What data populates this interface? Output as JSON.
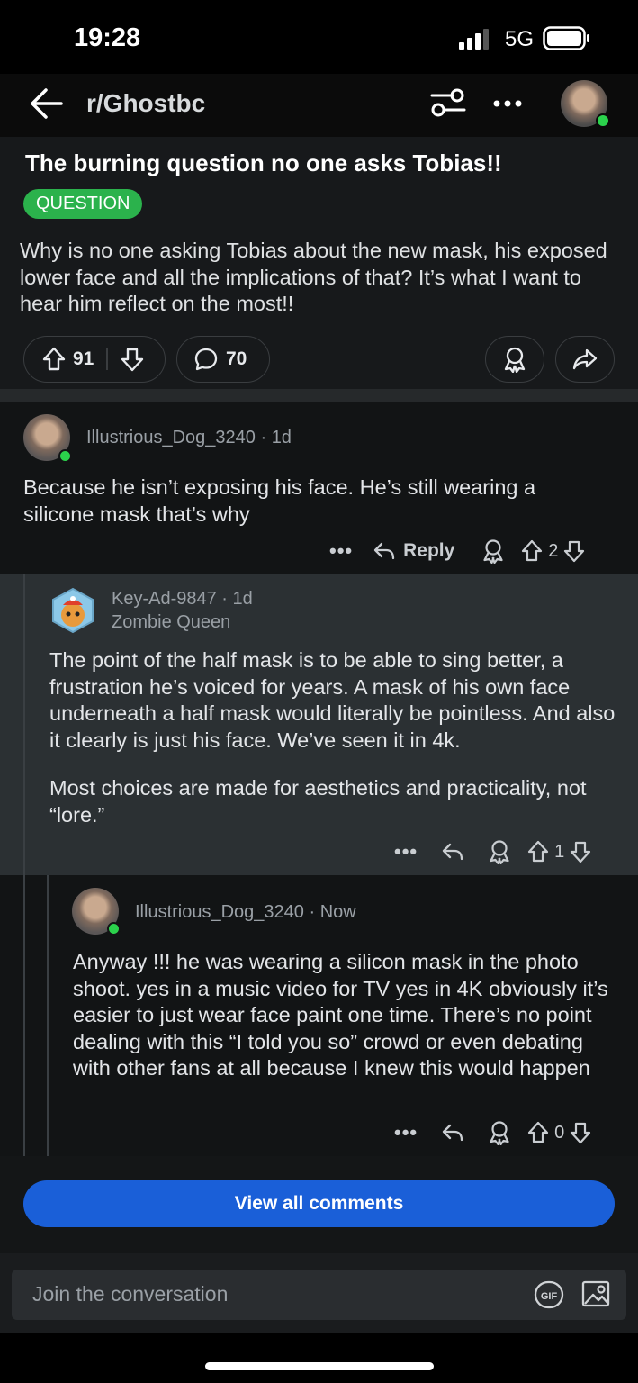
{
  "status": {
    "time": "19:28",
    "network": "5G"
  },
  "header": {
    "subreddit": "r/Ghostbc"
  },
  "post": {
    "title": "The burning question no one asks Tobias!!",
    "flair": "QUESTION",
    "body": "Why is no one asking Tobias about the new mask, his exposed lower face and all the implications of that? It’s what I want to hear him reflect on the most!!",
    "upvotes": "91",
    "comments": "70"
  },
  "comments": [
    {
      "author": "Illustrious_Dog_3240",
      "age": "1d",
      "text": "Because he isn’t exposing his face. He’s still wearing a silicone mask that’s why",
      "reply_label": "Reply",
      "score": "2"
    },
    {
      "author": "Key-Ad-9847",
      "age": "1d",
      "flair": "Zombie Queen",
      "text": "The point of the half mask is to be able to sing better, a frustration he’s voiced for years. A mask of his own face underneath a half mask would literally be pointless. And also it clearly is just his face. We’ve seen it in 4k.",
      "text2": "Most choices are made for aesthetics and practicality, not “lore.”",
      "score": "1"
    },
    {
      "author": "Illustrious_Dog_3240",
      "age": "Now",
      "text": "Anyway !!! he was wearing a silicon mask in the photo shoot. yes in a music video for TV yes in 4K obviously it’s easier to just wear face paint one time. There’s no point dealing with this “I told you so” crowd or even debating with other fans at all because I knew this would happen",
      "score": "0"
    }
  ],
  "view_all": "View all comments",
  "composer": {
    "placeholder": "Join the conversation"
  },
  "colors": {
    "accent_blue": "#1a5fd8",
    "flair_green": "#2bb24c",
    "online_green": "#2bd24c"
  }
}
